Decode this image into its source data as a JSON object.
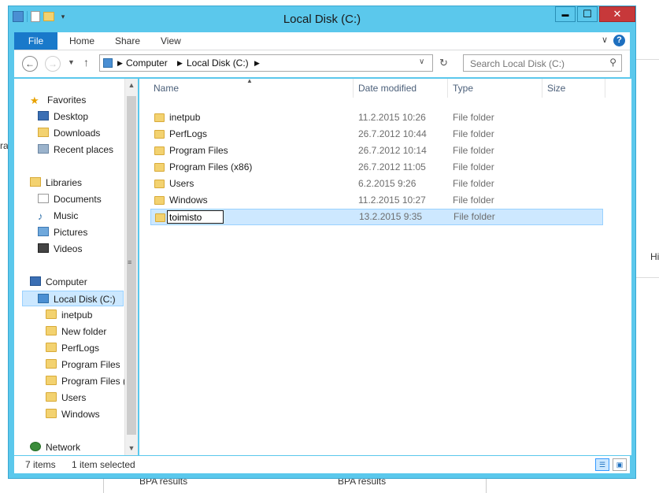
{
  "window": {
    "title": "Local Disk (C:)",
    "minimize": "▬",
    "maximize": "☐",
    "close": "✕"
  },
  "ribbon": {
    "tabs": [
      "File",
      "Home",
      "Share",
      "View"
    ],
    "help": "?"
  },
  "address": {
    "crumbs": [
      "Computer",
      "Local Disk (C:)"
    ],
    "search_placeholder": "Search Local Disk (C:)"
  },
  "nav": {
    "favorites_label": "Favorites",
    "favorites": [
      "Desktop",
      "Downloads",
      "Recent places"
    ],
    "libraries_label": "Libraries",
    "libraries": [
      "Documents",
      "Music",
      "Pictures",
      "Videos"
    ],
    "computer_label": "Computer",
    "selected_drive": "Local Disk (C:)",
    "drive_children": [
      "inetpub",
      "New folder",
      "PerfLogs",
      "Program Files",
      "Program Files (",
      "Users",
      "Windows"
    ],
    "network_label": "Network"
  },
  "columns": {
    "name": "Name",
    "date": "Date modified",
    "type": "Type",
    "size": "Size"
  },
  "files": [
    {
      "name": "inetpub",
      "date": "11.2.2015 10:26",
      "type": "File folder"
    },
    {
      "name": "PerfLogs",
      "date": "26.7.2012 10:44",
      "type": "File folder"
    },
    {
      "name": "Program Files",
      "date": "26.7.2012 10:14",
      "type": "File folder"
    },
    {
      "name": "Program Files (x86)",
      "date": "26.7.2012 11:05",
      "type": "File folder"
    },
    {
      "name": "Users",
      "date": "6.2.2015 9:26",
      "type": "File folder"
    },
    {
      "name": "Windows",
      "date": "11.2.2015 10:27",
      "type": "File folder"
    }
  ],
  "renaming": {
    "value": "toimisto",
    "date": "13.2.2015 9:35",
    "type": "File folder"
  },
  "status": {
    "count": "7 items",
    "selected": "1 item selected"
  },
  "background": {
    "left_fragment": "ra",
    "right_fragment": "Hi",
    "bottom_a": "BPA results",
    "bottom_b": "BPA results"
  },
  "colors": {
    "titlebar": "#5bc8ec",
    "file_tab": "#1979ca",
    "close": "#c7383a",
    "selection": "#cde8ff"
  }
}
